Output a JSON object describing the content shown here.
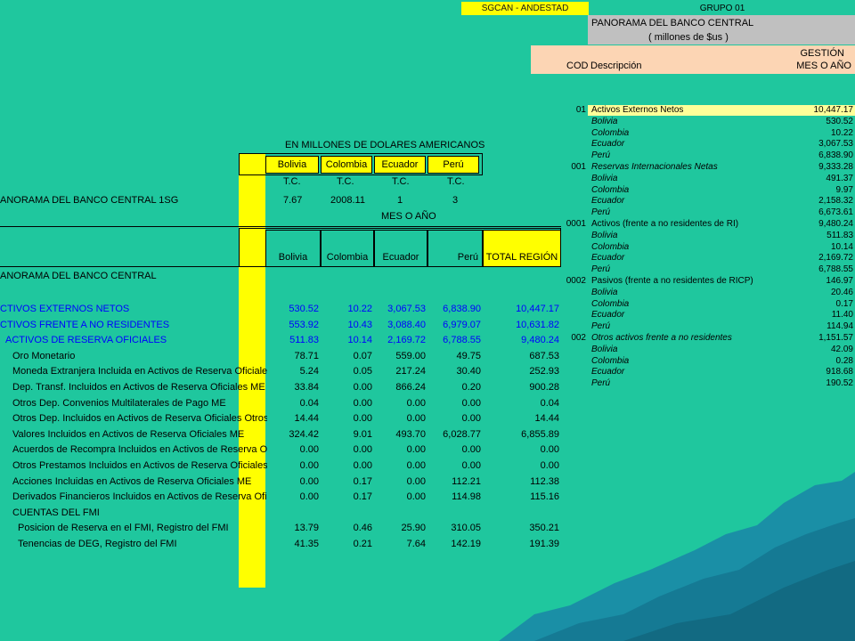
{
  "colors": {
    "background": "#1fc79e",
    "yellow": "#ffff00",
    "header_gray": "#c0c0c0",
    "header_peach": "#fcd5b4",
    "blue_text": "#0000ff"
  },
  "right_panel": {
    "group_left": "SGCAN - ANDESTAD",
    "group_right": "GRUPO 01",
    "title": "PANORAMA DEL BANCO CENTRAL",
    "subtitle": "( millones de $us )",
    "col_cod": "COD",
    "col_desc": "Descripción",
    "col_val_1": "GESTIÓN",
    "col_val_2": "MES O AÑO",
    "rows": [
      {
        "code": "01",
        "desc": "Activos Externos Netos",
        "value": "10,447.17",
        "hl": true
      },
      {
        "code": "",
        "desc": "Bolivia",
        "value": "530.52",
        "it": true
      },
      {
        "code": "",
        "desc": "Colombia",
        "value": "10.22",
        "it": true
      },
      {
        "code": "",
        "desc": "Ecuador",
        "value": "3,067.53",
        "it": true
      },
      {
        "code": "",
        "desc": "Perú",
        "value": "6,838.90",
        "it": true
      },
      {
        "code": "001",
        "desc": "Reservas Internacionales Netas",
        "value": "9,333.28",
        "it": true
      },
      {
        "code": "",
        "desc": "Bolivia",
        "value": "491.37",
        "it": true
      },
      {
        "code": "",
        "desc": "Colombia",
        "value": "9.97",
        "it": true
      },
      {
        "code": "",
        "desc": "Ecuador",
        "value": "2,158.32",
        "it": true
      },
      {
        "code": "",
        "desc": "Perú",
        "value": "6,673.61",
        "it": true
      },
      {
        "code": "0001",
        "desc": "Activos (frente a no residentes de RI)",
        "value": "9,480.24"
      },
      {
        "code": "",
        "desc": "Bolivia",
        "value": "511.83",
        "it": true
      },
      {
        "code": "",
        "desc": "Colombia",
        "value": "10.14",
        "it": true
      },
      {
        "code": "",
        "desc": "Ecuador",
        "value": "2,169.72",
        "it": true
      },
      {
        "code": "",
        "desc": "Perú",
        "value": "6,788.55",
        "it": true
      },
      {
        "code": "0002",
        "desc": "Pasivos (frente a no residentes de RICP)",
        "value": "146.97"
      },
      {
        "code": "",
        "desc": "Bolivia",
        "value": "20.46",
        "it": true
      },
      {
        "code": "",
        "desc": "Colombia",
        "value": "0.17",
        "it": true
      },
      {
        "code": "",
        "desc": "Ecuador",
        "value": "11.40",
        "it": true
      },
      {
        "code": "",
        "desc": "Perú",
        "value": "114.94",
        "it": true
      },
      {
        "code": "002",
        "desc": "Otros activos frente a no residentes",
        "value": "1,151.57",
        "it": true
      },
      {
        "code": "",
        "desc": "Bolivia",
        "value": "42.09",
        "it": true
      },
      {
        "code": "",
        "desc": "Colombia",
        "value": "0.28",
        "it": true
      },
      {
        "code": "",
        "desc": "Ecuador",
        "value": "918.68",
        "it": true
      },
      {
        "code": "",
        "desc": "Perú",
        "value": "190.52",
        "it": true
      }
    ]
  },
  "left_table": {
    "heading": "EN MILLONES DE DOLARES AMERICANOS",
    "countries": [
      "Bolivia",
      "Colombia",
      "Ecuador",
      "Perú"
    ],
    "tc_label": "T.C.",
    "tc_values": [
      "7.67",
      "2008.11",
      "1",
      "3"
    ],
    "row_title": "ANORAMA DEL BANCO CENTRAL 1SG",
    "period": "MES O AÑO",
    "cols": [
      "Bolivia",
      "Colombia",
      "Ecuador",
      "Perú",
      "TOTAL REGIÓN"
    ],
    "section_title": "ANORAMA DEL BANCO CENTRAL",
    "rows": [
      {
        "label": "CTIVOS EXTERNOS NETOS",
        "v": [
          "530.52",
          "10.22",
          "3,067.53",
          "6,838.90",
          "10,447.17"
        ],
        "blue": true
      },
      {
        "label": "CTIVOS FRENTE A NO RESIDENTES",
        "v": [
          "553.92",
          "10.43",
          "3,088.40",
          "6,979.07",
          "10,631.82"
        ],
        "blue": true
      },
      {
        "label": "ACTIVOS DE RESERVA OFICIALES",
        "v": [
          "511.83",
          "10.14",
          "2,169.72",
          "6,788.55",
          "9,480.24"
        ],
        "blue": true,
        "indent": 6
      },
      {
        "label": "Oro Monetario",
        "v": [
          "78.71",
          "0.07",
          "559.00",
          "49.75",
          "687.53"
        ],
        "indent": 14
      },
      {
        "label": "Moneda Extranjera Incluida en Activos de Reserva Oficiales",
        "v": [
          "5.24",
          "0.05",
          "217.24",
          "30.40",
          "252.93"
        ],
        "indent": 14
      },
      {
        "label": "Dep. Transf. Incluidos en Activos de Reserva Oficiales ME",
        "v": [
          "33.84",
          "0.00",
          "866.24",
          "0.20",
          "900.28"
        ],
        "indent": 14
      },
      {
        "label": "Otros Dep. Convenios Multilaterales de Pago ME",
        "v": [
          "0.04",
          "0.00",
          "0.00",
          "0.00",
          "0.04"
        ],
        "indent": 14
      },
      {
        "label": "Otros Dep. Incluidos en Activos de Reserva Oficiales Otros ME",
        "v": [
          "14.44",
          "0.00",
          "0.00",
          "0.00",
          "14.44"
        ],
        "indent": 14
      },
      {
        "label": "Valores Incluidos en Activos de Reserva Oficiales ME",
        "v": [
          "324.42",
          "9.01",
          "493.70",
          "6,028.77",
          "6,855.89"
        ],
        "indent": 14
      },
      {
        "label": "Acuerdos de Recompra Incluidos en Activos de Reserva Oficiales",
        "v": [
          "0.00",
          "0.00",
          "0.00",
          "0.00",
          "0.00"
        ],
        "indent": 14
      },
      {
        "label": "Otros Prestamos Incluidos en Activos de Reserva Oficiales ME",
        "v": [
          "0.00",
          "0.00",
          "0.00",
          "0.00",
          "0.00"
        ],
        "indent": 14
      },
      {
        "label": "Acciones Incluidas en Activos de Reserva Oficiales ME",
        "v": [
          "0.00",
          "0.17",
          "0.00",
          "112.21",
          "112.38"
        ],
        "indent": 14
      },
      {
        "label": "Derivados Financieros Incluidos en Activos de Reserva Oficiales M",
        "v": [
          "0.00",
          "0.17",
          "0.00",
          "114.98",
          "115.16"
        ],
        "indent": 14
      },
      {
        "label": "CUENTAS DEL FMI",
        "v": [
          "",
          "",
          "",
          "",
          ""
        ],
        "indent": 14
      },
      {
        "label": "Posicion de Reserva en el FMI, Registro del FMI",
        "v": [
          "13.79",
          "0.46",
          "25.90",
          "310.05",
          "350.21"
        ],
        "indent": 20
      },
      {
        "label": "Tenencias de DEG, Registro del FMI",
        "v": [
          "41.35",
          "0.21",
          "7.64",
          "142.19",
          "191.39"
        ],
        "indent": 20
      }
    ]
  }
}
